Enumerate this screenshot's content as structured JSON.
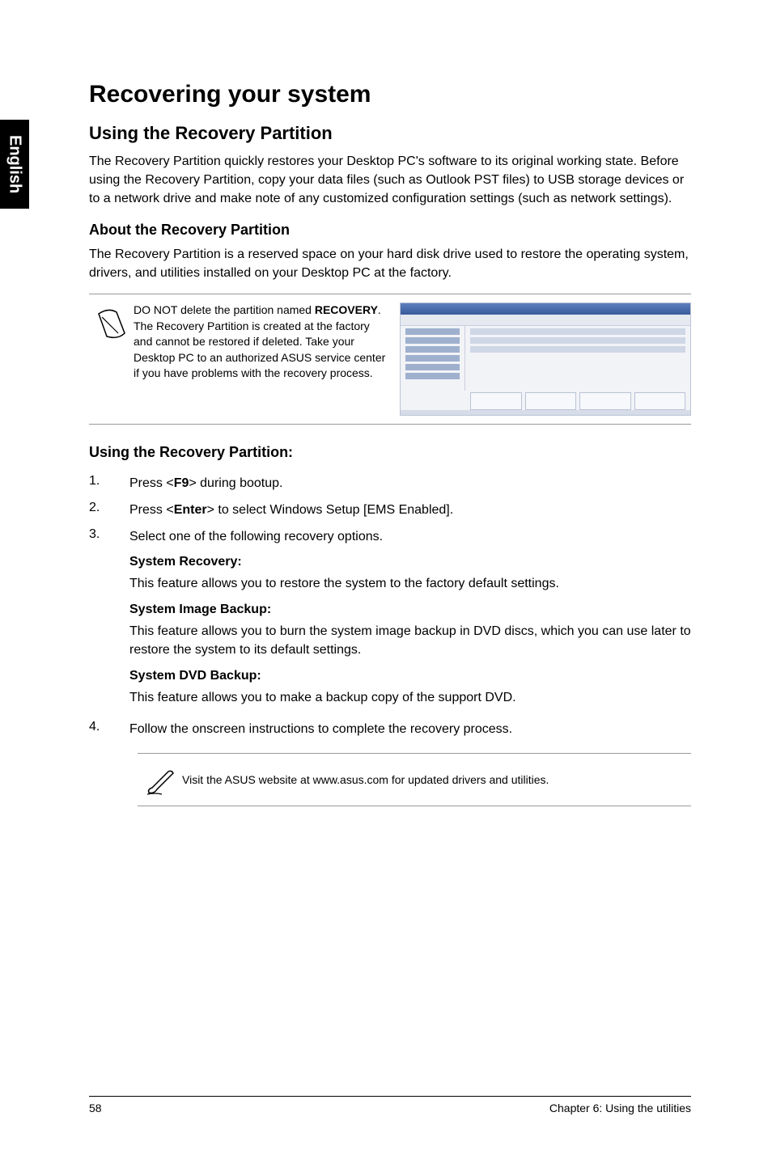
{
  "side_label": "English",
  "h1": "Recovering your system",
  "h2": "Using the Recovery Partition",
  "intro": "The Recovery Partition quickly restores your Desktop PC's software to its original working state. Before using the Recovery Partition, copy your data files (such as Outlook PST files) to USB storage devices or to a network drive and make note of any customized configuration settings (such as network settings).",
  "h3_about": "About the Recovery Partition",
  "about_text": "The Recovery Partition is a reserved space on your hard disk drive used to restore the operating system, drivers, and utilities installed on your Desktop PC at the factory.",
  "warn_pre": "DO NOT delete the partition named ",
  "warn_bold": "RECOVERY",
  "warn_post": ". The Recovery Partition is created at the factory and cannot be restored if deleted. Take your Desktop PC to an authorized ASUS service center if you have problems with the recovery process.",
  "using_heading": "Using the Recovery Partition:",
  "steps": {
    "s1_pre": "Press <",
    "s1_key": "F9",
    "s1_post": "> during bootup.",
    "s2_pre": "Press <",
    "s2_key": "Enter",
    "s2_post": "> to select Windows Setup [EMS Enabled].",
    "s3": "Select one of the following recovery options.",
    "s4": "Follow the onscreen instructions to complete the recovery process."
  },
  "opts": {
    "sys_rec_h": "System Recovery:",
    "sys_rec_t": "This feature allows you to restore the system to the factory default settings.",
    "img_bak_h": "System Image Backup:",
    "img_bak_t": "This feature allows you to burn the system image backup in DVD discs, which you can use later to restore the system to its default settings.",
    "dvd_bak_h": "System DVD Backup:",
    "dvd_bak_t": "This feature allows you to make a backup copy of the support DVD."
  },
  "bottom_note": "Visit the ASUS website at www.asus.com for updated drivers and utilities.",
  "footer_left": "58",
  "footer_right": "Chapter 6: Using the utilities",
  "nums": {
    "n1": "1.",
    "n2": "2.",
    "n3": "3.",
    "n4": "4."
  }
}
